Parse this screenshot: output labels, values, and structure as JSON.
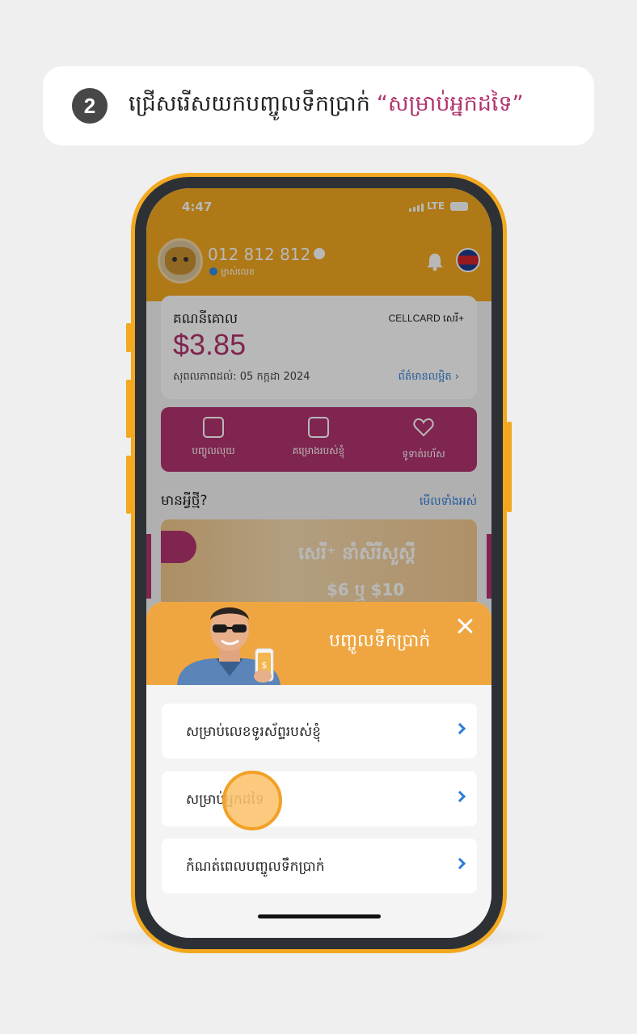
{
  "instruction": {
    "step": "2",
    "text": "ជ្រើសរើសយកបញ្ចូលទឹកប្រាក់",
    "highlight": "“សម្រាប់អ្នកដទៃ”"
  },
  "status_bar": {
    "time": "4:47",
    "network": "LTE"
  },
  "profile": {
    "phone_number": "012 812 812",
    "plan": "ម្ចាស់លេខ"
  },
  "balance": {
    "title": "គណនីគោល",
    "brand": "CELLCARD សេរី+",
    "amount": "$3.85",
    "validity": "សុពលភាពដល់: 05 កក្កដា 2024",
    "details_link": "ព័ត៌មានលម្អិត"
  },
  "quick_actions": [
    {
      "label": "បញ្ចូលលុយ",
      "icon": "topup-icon"
    },
    {
      "label": "គម្រោងរបស់ខ្ញុំ",
      "icon": "plan-card-icon"
    },
    {
      "label": "ទូទាត់រហ័ស",
      "icon": "heart-icon"
    }
  ],
  "news": {
    "title": "មានអ្វីថ្មី?",
    "see_all": "មើលទាំងអស់"
  },
  "banner": {
    "headline": "សេរី⁺ នាំសិរីសួស្ដី",
    "price": "$6 ឬ $10"
  },
  "sheet": {
    "title": "បញ្ចូលទឹកប្រាក់",
    "options": [
      {
        "label": "សម្រាប់លេខទូរស័ព្ទរបស់ខ្ញុំ"
      },
      {
        "label": "សម្រាប់អ្នកដទៃ"
      },
      {
        "label": "កំណត់ពេលបញ្ចូលទឹកប្រាក់"
      }
    ]
  },
  "colors": {
    "brand_orange": "#f2a81f",
    "brand_magenta": "#b1346e",
    "link_blue": "#2e7dd6"
  }
}
